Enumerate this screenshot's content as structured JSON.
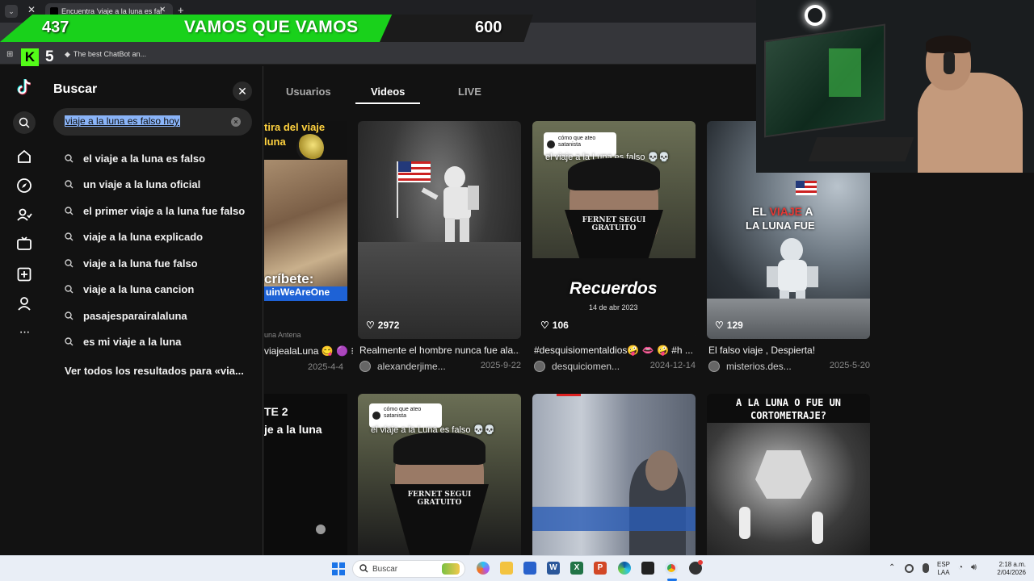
{
  "browser": {
    "tab_title": "Encuentra 'viaje a la luna es fal",
    "bookmark_label": "The best ChatBot an...",
    "url_fragment": "806198"
  },
  "overlay": {
    "left_number": "437",
    "title": "VAMOS QUE VAMOS",
    "right_number": "600",
    "kick_count": "5"
  },
  "search": {
    "title": "Buscar",
    "query": "viaje a la luna es falso hoy",
    "suggestions": [
      "el viaje a la luna es falso",
      "un viaje a la luna oficial",
      "el primer viaje a la luna fue falso",
      "viaje a la luna explicado",
      "viaje a la luna fue falso",
      "viaje a la luna cancion",
      "pasajesparairalaluna",
      "es mi viaje a la luna"
    ],
    "see_all": "Ver todos los resultados para «via..."
  },
  "tabs": [
    {
      "label": "Usuarios"
    },
    {
      "label": "Videos"
    },
    {
      "label": "LIVE"
    }
  ],
  "partial_card": {
    "caption_top": "tira del viaje",
    "caption_top2": "luna",
    "subscribe": "críbete:",
    "hashtag": "uinWeAreOne",
    "desc": "viajealaLuna",
    "date": "2025-4-4",
    "bottom_caption1": "TE 2",
    "bottom_caption2": "je a la luna",
    "small_label": "una Antena"
  },
  "cards": [
    {
      "likes": "2972",
      "desc": "Realmente el hombre nunca fue ala...",
      "author": "alexanderjime...",
      "date": "2025-9-22"
    },
    {
      "likes": "106",
      "desc": "#desquisiomentaldios",
      "desc_tail": " #h ...",
      "author": "desquiciomen...",
      "date": "2024-12-14",
      "overlay_title": "Recuerdos",
      "overlay_sub": "14 de abr 2023",
      "overlay_caption": "el viaje a la Luna es falso",
      "reply_text": "cómo que ateo satanista",
      "mask_text": "FERNET SEGUI GRATUITO"
    },
    {
      "likes": "129",
      "desc": "El falso viaje , Despierta!",
      "author": "misterios.des...",
      "date": "2025-5-20",
      "overlay_line1": "EL VIAJE A",
      "overlay_line2": "LA LUNA FUE"
    }
  ],
  "row2": {
    "card1_caption": "el viaje a la Luna es falso",
    "card1_reply": "cómo que ateo satanista",
    "card1_mask": "FERNET SEGUI GRATUITO",
    "card3_line1": "A LA LUNA O FUE UN",
    "card3_line2": "CORTOMETRAJE?"
  },
  "taskbar": {
    "search_placeholder": "Buscar",
    "lang_top": "ESP",
    "lang_bottom": "LAA",
    "time": "2:18 a.m.",
    "date": "2/04/2026"
  },
  "colors": {
    "overlay_green": "#19d11b",
    "background": "#121212",
    "selection": "#8ab4f8"
  }
}
